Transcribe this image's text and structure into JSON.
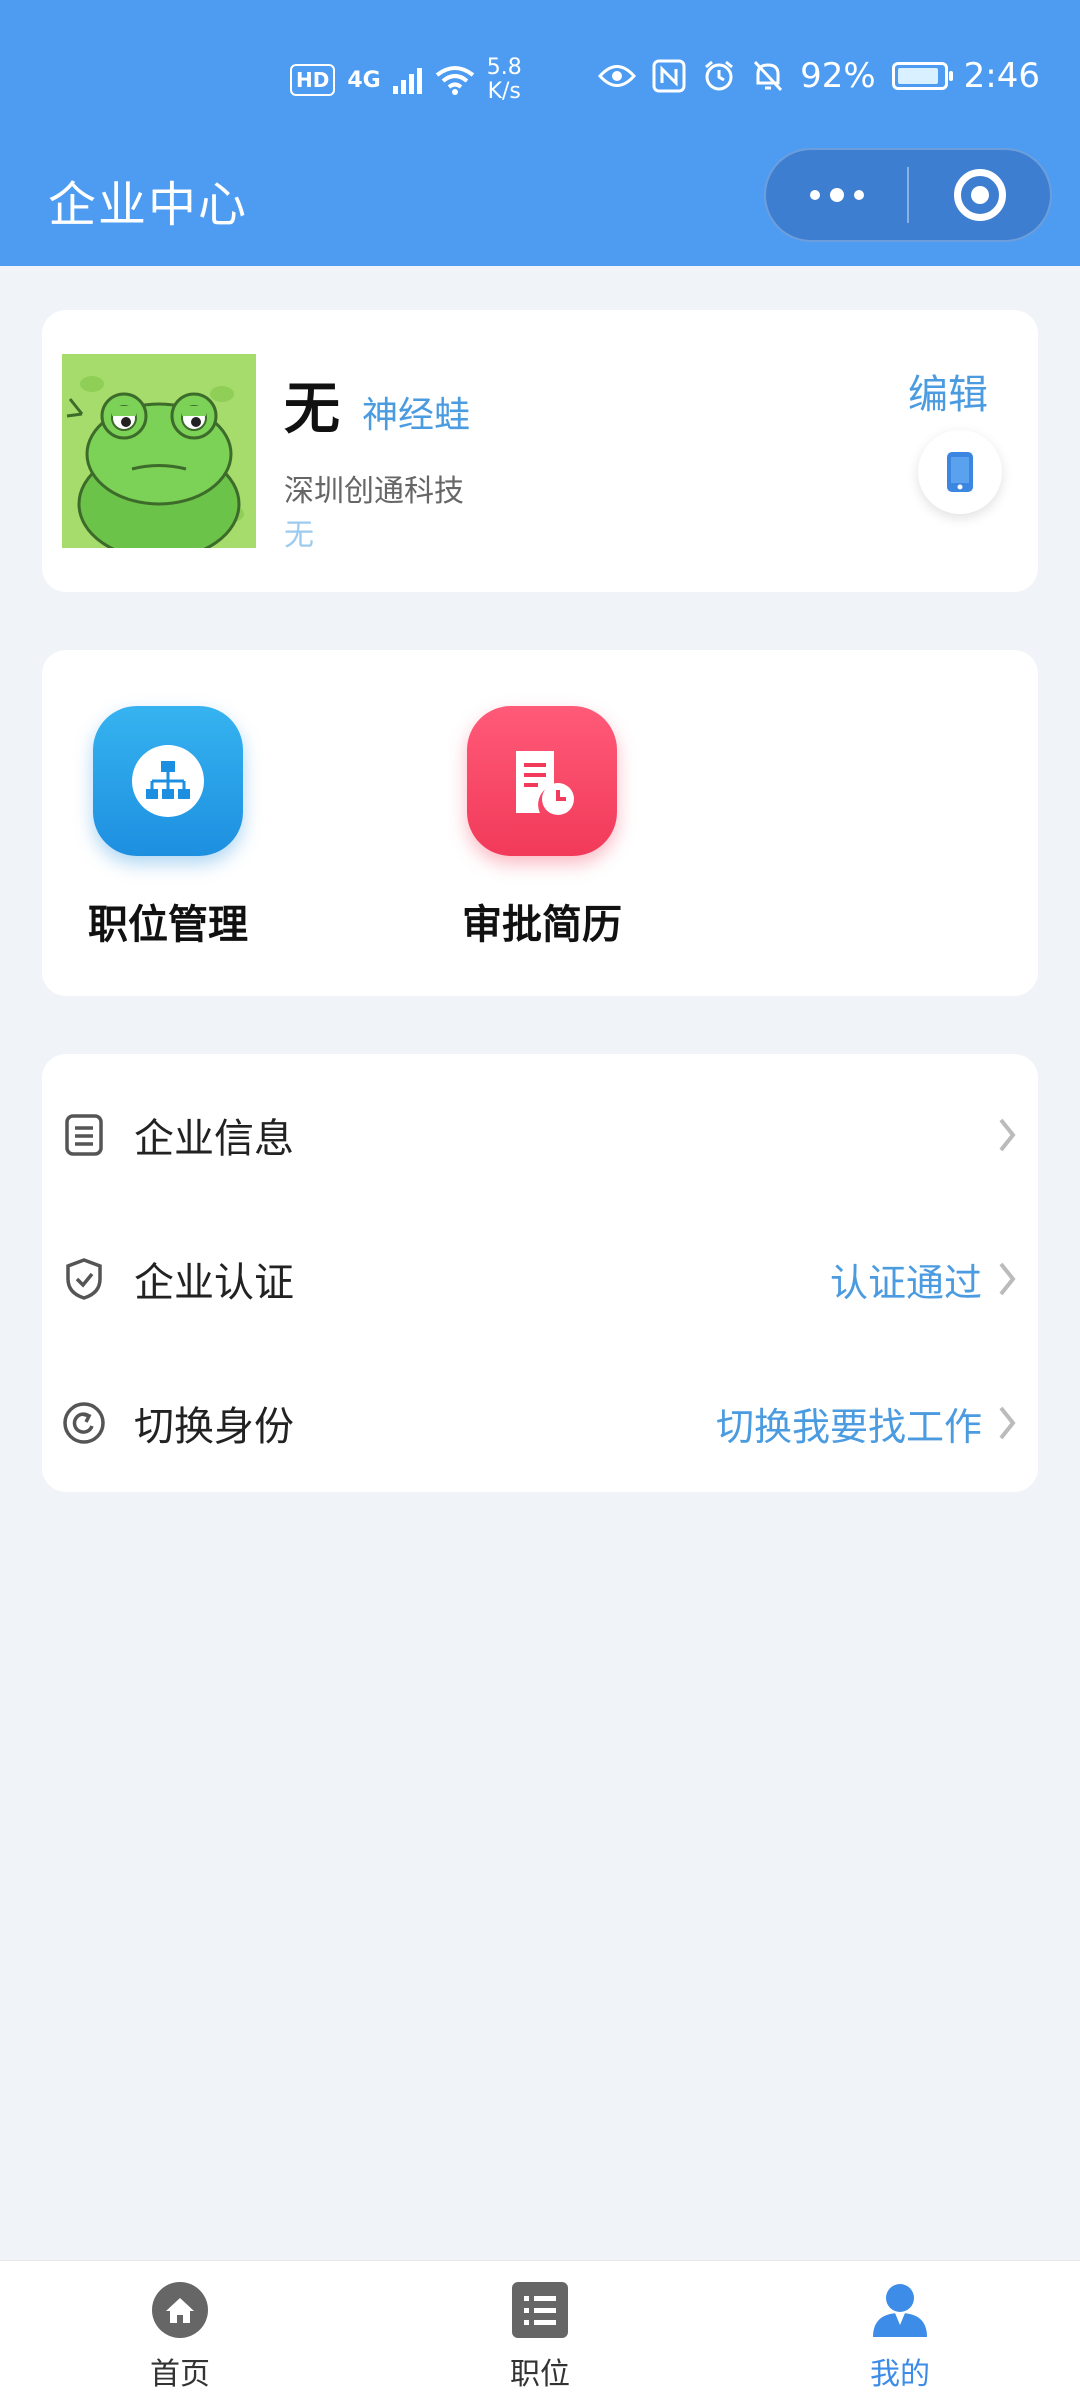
{
  "status_bar": {
    "hd": "HD",
    "network": "4G",
    "speed_value": "5.8",
    "speed_unit": "K/s",
    "battery": "92%",
    "battery_level": 0.92,
    "time": "2:46"
  },
  "header": {
    "title": "企业中心"
  },
  "profile": {
    "name": "无",
    "nickname": "神经蛙",
    "company": "深圳创通科技",
    "extra": "无",
    "edit_label": "编辑"
  },
  "quick_actions": [
    {
      "label": "职位管理",
      "icon": "org-chart-icon",
      "color": "#1d8fe0"
    },
    {
      "label": "审批简历",
      "icon": "document-clock-icon",
      "color": "#f23a5a"
    }
  ],
  "menu": [
    {
      "label": "企业信息",
      "value": "",
      "icon": "document-icon"
    },
    {
      "label": "企业认证",
      "value": "认证通过",
      "icon": "shield-check-icon"
    },
    {
      "label": "切换身份",
      "value": "切换我要找工作",
      "icon": "switch-icon"
    }
  ],
  "tabs": [
    {
      "label": "首页",
      "icon": "home-icon"
    },
    {
      "label": "职位",
      "icon": "list-icon"
    },
    {
      "label": "我的",
      "icon": "user-icon",
      "active": true
    }
  ],
  "colors": {
    "header": "#4d9cf2",
    "accent": "#4b9be0",
    "background": "#f0f3f7"
  }
}
